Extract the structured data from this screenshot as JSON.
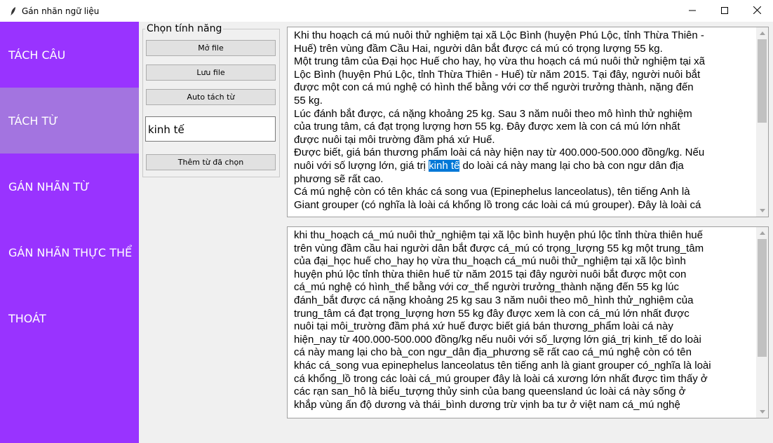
{
  "window": {
    "title": "Gán nhãn ngữ liệu",
    "icons": [
      "feather-icon",
      "minimize-icon",
      "maximize-icon",
      "close-icon"
    ]
  },
  "sidebar": {
    "items": [
      {
        "label": "TÁCH CÂU",
        "active": false
      },
      {
        "label": "TÁCH TỪ",
        "active": true
      },
      {
        "label": "GÁN NHÃN TỪ",
        "active": false
      },
      {
        "label": "GÁN NHÃN THỰC THỂ",
        "active": false
      },
      {
        "label": "THOÁT",
        "active": false
      }
    ]
  },
  "features": {
    "legend": "Chọn tính năng",
    "open_file": "Mở file",
    "save_file": "Lưu file",
    "auto_split": "Auto tách từ",
    "entry_value": "kinh tế",
    "add_selected": "Thêm từ đã chọn"
  },
  "source_text": {
    "lines": [
      "Khi thu hoạch cá mú nuôi thử nghiệm tại xã Lộc Bình (huyện Phú Lộc, tỉnh Thừa Thiên -",
      "Huế) trên vùng đầm Cầu Hai, người dân bắt được cá mú có trọng lượng 55 kg.",
      "Một trung tâm của Đại học Huế cho hay, họ vừa thu hoạch cá mú nuôi thử nghiệm tại xã",
      "Lộc Bình (huyện Phú Lộc, tỉnh Thừa Thiên - Huế) từ năm 2015. Tại đây, người nuôi bắt",
      "được một con cá mú nghệ có hình thể bằng với cơ thể người trưởng thành, nặng đến",
      "55 kg.",
      "Lúc đánh bắt được, cá nặng khoảng 25 kg. Sau 3 năm nuôi theo mô hình thử nghiệm",
      "của trung tâm, cá đạt trọng lượng hơn 55 kg. Đây được xem là con cá mú lớn nhất",
      "được nuôi tại môi trường đầm phá xứ Huế.",
      "Được biết, giá bán thương phẩm loài cá này hiện nay từ 400.000-500.000 đồng/kg. Nếu"
    ],
    "line_with_selection": {
      "before": "nuôi với số lượng lớn, giá trị ",
      "selected": "kinh tế",
      "after": " do loài cá này mang lại cho bà con ngư dân địa"
    },
    "lines_after": [
      "phương sẽ rất cao.",
      "Cá mú nghệ còn có tên khác cá song vua (Epinephelus lanceolatus), tên tiếng Anh là",
      "Giant grouper (có nghĩa là loài cá khổng lồ trong các loài cá mú grouper). Đây là loài cá"
    ]
  },
  "tokenized_text": {
    "lines": [
      "khi thu_hoạch cá_mú nuôi thử_nghiệm tại xã lộc bình huyện phú lộc tỉnh thừa thiên huế",
      "trên vùng đầm cầu hai người dân bắt được cá_mú có trọng_lượng 55 kg một trung_tâm",
      "của đại_học huế cho_hay họ vừa thu_hoạch cá_mú nuôi thử_nghiệm tại xã lộc bình",
      "huyện phú lộc tỉnh thừa thiên huế từ năm 2015 tại đây người nuôi bắt được một con",
      "cá_mú nghệ có hình_thể bằng với cơ_thể người trưởng_thành nặng đến 55 kg lúc",
      "đánh_bắt được cá nặng khoảng 25 kg sau 3 năm nuôi theo mô_hình thử_nghiệm của",
      "trung_tâm cá đạt trọng_lượng hơn 55 kg đây được xem là con cá_mú lớn nhất được",
      "nuôi tại môi_trường đầm phá xứ huế được biết giá bán thương_phẩm loài cá này",
      "hiện_nay từ 400.000-500.000 đồng/kg nếu nuôi với số_lượng lớn giá_trị kinh_tế do loài",
      "cá này mang lại cho bà_con ngư_dân địa_phương sẽ rất cao cá_mú nghệ còn có tên",
      "khác cá_song vua epinephelus lanceolatus tên tiếng anh là giant grouper có_nghĩa là loài",
      "cá khổng_lồ trong các loài cá_mú grouper đây là loài cá xương lớn nhất được tìm thấy ở",
      "các rạn san_hô là biểu_tượng thủy sinh của bang queensland úc loài cá này sống ở",
      "khắp vùng ấn độ dương và thái_bình dương trừ vịnh ba tư ở việt nam cá_mú nghệ"
    ]
  },
  "colors": {
    "sidebar_bg": "#9933ff",
    "sidebar_active_bg": "#a374e0",
    "selection_bg": "#0078d7"
  }
}
